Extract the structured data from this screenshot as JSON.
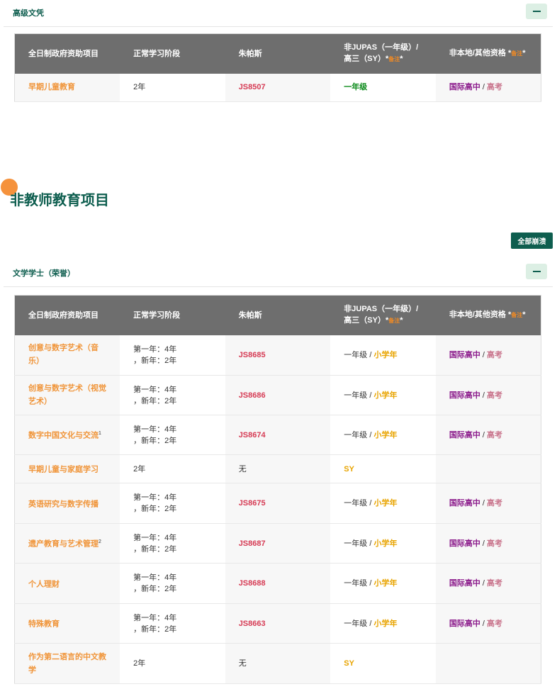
{
  "accordion1": {
    "title": "高级文凭",
    "headers": {
      "col1": "全日制政府资助项目",
      "col2": "正常学习阶段",
      "col3": "朱帕斯",
      "col4_line1": "非JUPAS（一年级）/",
      "col4_line2": "高三（SY）*",
      "col4_note": "备注",
      "col4_end": "*",
      "col5": "非本地/其他资格 *",
      "col5_note": "备注",
      "col5_end": "*"
    },
    "rows": [
      {
        "name": "早期儿童教育",
        "duration": "2年",
        "code": "JS8507",
        "nonjupas": "一年级",
        "intl": "国际高中",
        "sep": " / ",
        "gaokao": "高考"
      }
    ]
  },
  "section": {
    "title": "非教师教育项目",
    "collapse_all": "全部崩溃"
  },
  "accordion2": {
    "title": "文学学士（荣誉）",
    "headers": {
      "col1": "全日制政府资助项目",
      "col2": "正常学习阶段",
      "col3": "朱帕斯",
      "col4_line1": "非JUPAS（一年级）/",
      "col4_line2": "高三（SY）*",
      "col4_note": "备注",
      "col4_end": "*",
      "col5": "非本地/其他资格 *",
      "col5_note": "备注",
      "col5_end": "*"
    },
    "rows": [
      {
        "name": "创意与数字艺术（音乐）",
        "sup": "",
        "dur1": "第一年：4年",
        "dur2": "，新年：2年",
        "code": "JS8685",
        "y1": "一年级",
        "sep": " / ",
        "sy": "小学年",
        "intl": "国际高中",
        "gaokao": "高考"
      },
      {
        "name": "创意与数字艺术（视觉艺术）",
        "sup": "",
        "dur1": "第一年：4年",
        "dur2": "，新年：2年",
        "code": "JS8686",
        "y1": "一年级",
        "sep": " / ",
        "sy": "小学年",
        "intl": "国际高中",
        "gaokao": "高考"
      },
      {
        "name": "数字中国文化与交流",
        "sup": "1",
        "dur1": "第一年：4年",
        "dur2": "，新年：2年",
        "code": "JS8674",
        "y1": "一年级",
        "sep": " / ",
        "sy": "小学年",
        "intl": "国际高中",
        "gaokao": "高考"
      },
      {
        "name": "早期儿童与家庭学习",
        "sup": "",
        "dur1": "2年",
        "dur2": "",
        "code": "无",
        "y1": "",
        "sep": "",
        "sy": "SY",
        "intl": "",
        "gaokao": ""
      },
      {
        "name": "英语研究与数字传播",
        "sup": "",
        "dur1": "第一年：4年",
        "dur2": "，新年：2年",
        "code": "JS8675",
        "y1": "一年级",
        "sep": " / ",
        "sy": "小学年",
        "intl": "国际高中",
        "gaokao": "高考"
      },
      {
        "name": "遗产教育与艺术管理",
        "sup": "2",
        "dur1": "第一年：4年",
        "dur2": "，新年：2年",
        "code": "JS8687",
        "y1": "一年级",
        "sep": " / ",
        "sy": "小学年",
        "intl": "国际高中",
        "gaokao": "高考"
      },
      {
        "name": "个人理财",
        "sup": "",
        "dur1": "第一年：4年",
        "dur2": "，新年：2年",
        "code": "JS8688",
        "y1": "一年级",
        "sep": " / ",
        "sy": "小学年",
        "intl": "国际高中",
        "gaokao": "高考"
      },
      {
        "name": "特殊教育",
        "sup": "",
        "dur1": "第一年：4年",
        "dur2": "，新年：2年",
        "code": "JS8663",
        "y1": "一年级",
        "sep": " / ",
        "sy": "小学年",
        "intl": "国际高中",
        "gaokao": "高考"
      },
      {
        "name": "作为第二语言的中文教学",
        "sup": "",
        "dur1": "2年",
        "dur2": "",
        "code": "无",
        "y1": "",
        "sep": "",
        "sy": "SY",
        "intl": "",
        "gaokao": ""
      }
    ]
  },
  "icons": {
    "toggle": "minus-icon",
    "section_marker": "orange-dot-icon"
  },
  "colors": {
    "brand": "#0e5e4f",
    "header_bg": "#6e6e6e",
    "program": "#f0953a",
    "code": "#d63b54",
    "green": "#0b8a1a",
    "yellow": "#e8a400",
    "purple": "#8b1a8b",
    "pink": "#c9748c"
  }
}
